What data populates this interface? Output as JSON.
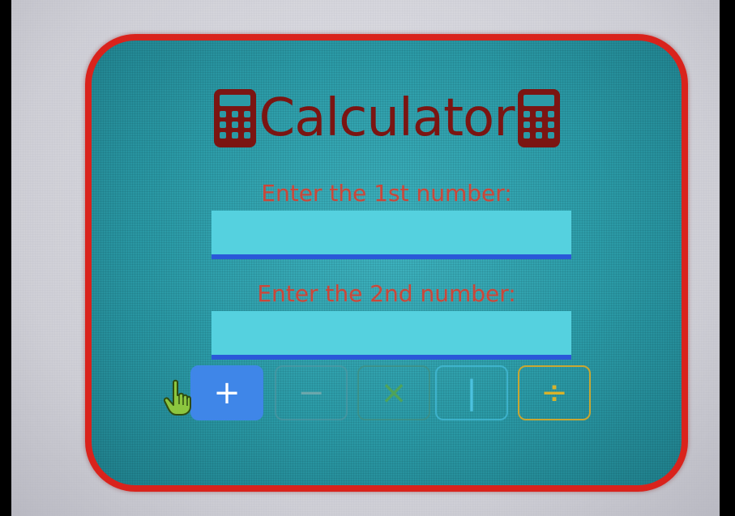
{
  "app": {
    "title": "Calculator"
  },
  "form": {
    "first_label": "Enter the 1st number:",
    "first_value": "",
    "second_label": "Enter the 2nd number:",
    "second_value": ""
  },
  "operations": {
    "add": "+",
    "subtract": "−",
    "multiply": "×",
    "pipe": "|",
    "divide": "÷"
  },
  "icons": {
    "title_left": "calculator-icon",
    "title_right": "calculator-icon",
    "pointer": "hand-pointer-icon"
  },
  "colors": {
    "border": "#d9231c",
    "title": "#7b1512",
    "label": "#c9473a",
    "field_bg": "#55d1df",
    "field_underline": "#2a58d8",
    "add_button": "#3f86e8",
    "divide_button": "#d9b22a",
    "cursor": "#8cc63f"
  }
}
